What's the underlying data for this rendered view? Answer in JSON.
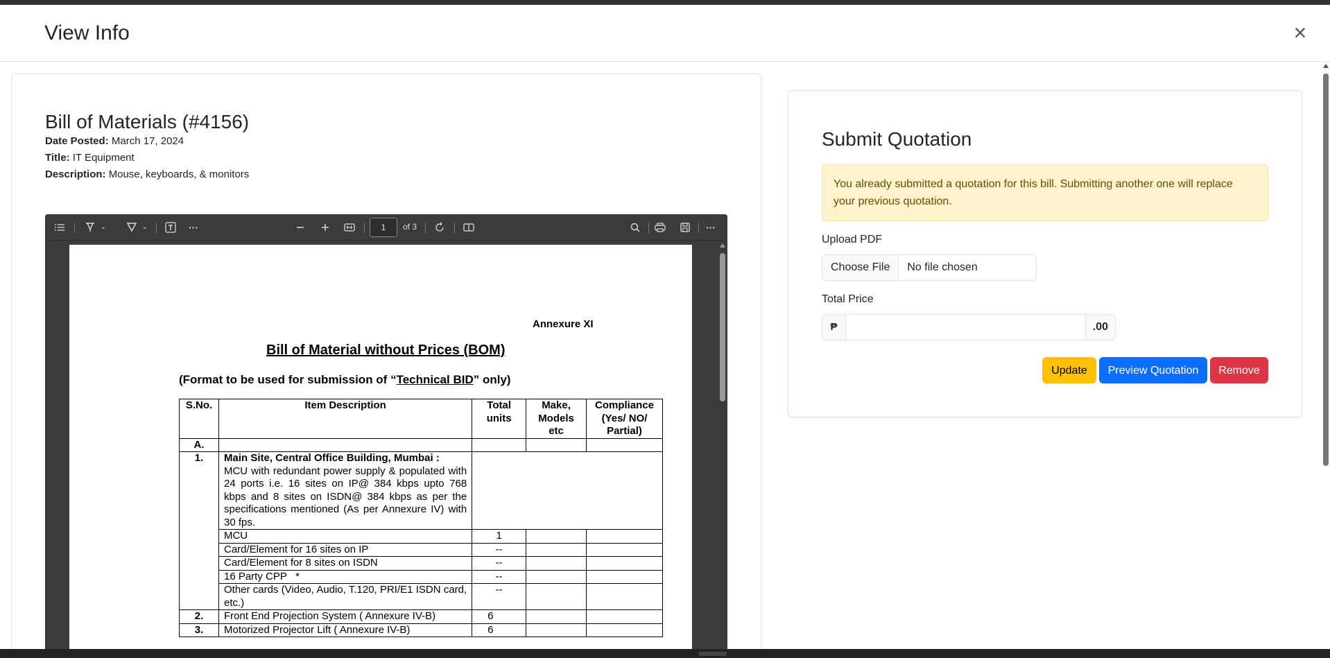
{
  "modal": {
    "title": "View Info",
    "close_label": "×"
  },
  "bill": {
    "heading": "Bill of Materials (#4156)",
    "date_label": "Date Posted:",
    "date_value": "March 17, 2024",
    "title_label": "Title:",
    "title_value": "IT Equipment",
    "desc_label": "Description:",
    "desc_value": "Mouse, keyboards, & monitors"
  },
  "pdf_viewer": {
    "current_page": "1",
    "page_count_text": "of 3",
    "toolbar_icons": [
      "contents-icon",
      "draw-icon",
      "highlight-icon",
      "text-icon",
      "more-icon",
      "zoom-out-icon",
      "zoom-in-icon",
      "fit-page-icon",
      "rotate-icon",
      "page-view-icon",
      "search-icon",
      "print-icon",
      "save-icon",
      "more-options-icon"
    ]
  },
  "document": {
    "annexure": "Annexure XI",
    "title": "Bill of Material without Prices (BOM)",
    "subtitle_pre": "(Format to be used for submission of “",
    "subtitle_u": "Technical BID",
    "subtitle_post": "” only)",
    "headers": {
      "sno": "S.No.",
      "desc": "Item Description",
      "units": "Total units",
      "make": "Make, Models etc",
      "comp": "Compliance (Yes/ NO/ Partial)"
    },
    "section_a": "A.",
    "row1_sno": "1.",
    "row1_heading": "Main Site, Central Office Building, Mumbai :",
    "row1_text": "MCU with redundant power supply & populated with 24 ports i.e. 16 sites on IP@ 384 kbps upto 768 kbps and 8 sites on ISDN@ 384 kbps as per the specifications mentioned (As per Annexure IV) with 30 fps.",
    "sub_rows": [
      {
        "desc": "MCU",
        "units": "1"
      },
      {
        "desc": "Card/Element for 16 sites on IP",
        "units": "--"
      },
      {
        "desc": "Card/Element for 8 sites on ISDN",
        "units": "--"
      },
      {
        "desc": "16 Party CPP   *",
        "units": "--"
      },
      {
        "desc": "Other cards (Video, Audio, T.120, PRI/E1 ISDN card,  etc.)",
        "units": "--"
      }
    ],
    "row2_sno": "2.",
    "row2_desc": "Front End Projection System ( Annexure  IV-B)",
    "row2_units": "6",
    "row3_sno": "3.",
    "row3_desc": "Motorized Projector Lift  ( Annexure  IV-B)",
    "row3_units": "6"
  },
  "quotation": {
    "title": "Submit Quotation",
    "alert": "You already submitted a quotation for this bill. Submitting another one will replace your previous quotation.",
    "upload_label": "Upload PDF",
    "choose_file": "Choose File",
    "no_file": "No file chosen",
    "price_label": "Total Price",
    "currency": "₱",
    "price_value": "",
    "cents": ".00",
    "btn_update": "Update",
    "btn_preview": "Preview Quotation",
    "btn_remove": "Remove"
  },
  "colors": {
    "warning": "#ffc107",
    "primary": "#0d6efd",
    "danger": "#dc3545",
    "alert_bg": "#fff3cd",
    "pdf_chrome": "#3b3b3b"
  }
}
